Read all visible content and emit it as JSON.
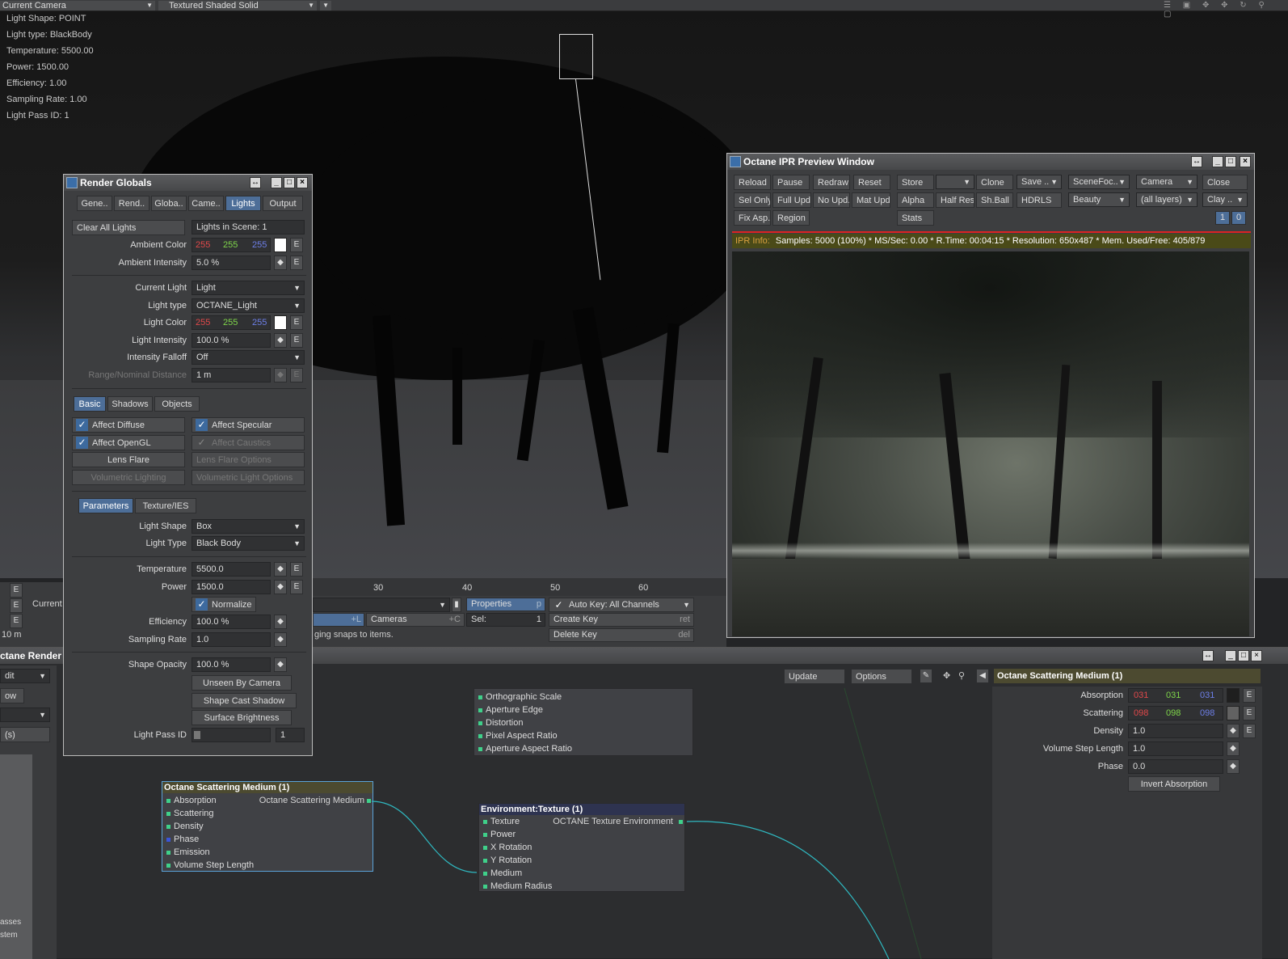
{
  "viewport": {
    "camera_dropdown": "Current Camera",
    "shading_dropdown": "Textured Shaded Solid",
    "info": [
      "Light Shape: POINT",
      "Light type: BlackBody",
      "Temperature: 5500.00",
      "Power: 1500.00",
      "Efficiency: 1.00",
      "Sampling Rate: 1.00",
      "Light Pass ID: 1"
    ]
  },
  "timeline": {
    "ticks": [
      "30",
      "40",
      "50",
      "60"
    ],
    "left_e": "E",
    "current_label": "Current",
    "size_label": "10 m",
    "properties": "Properties",
    "properties_key": "p",
    "auto_key": "Auto Key: All Channels",
    "cameras_shortcut": "+L",
    "cameras": "Cameras",
    "cameras_key": "+C",
    "sel_label": "Sel:",
    "sel_value": "1",
    "create_key": "Create Key",
    "create_key_shortcut": "ret",
    "delete_key": "Delete Key",
    "delete_key_shortcut": "del",
    "status": "ging snaps to items."
  },
  "render_globals": {
    "title": "Render Globals",
    "tabs": [
      "Gene..",
      "Rend..",
      "Globa..",
      "Came..",
      "Lights",
      "Output"
    ],
    "clear_all_lights": "Clear All Lights",
    "lights_in_scene": "Lights in Scene: 1",
    "ambient_color_label": "Ambient Color",
    "ambient_color": [
      "255",
      "255",
      "255"
    ],
    "ambient_intensity_label": "Ambient Intensity",
    "ambient_intensity": "5.0 %",
    "current_light_label": "Current Light",
    "current_light": "Light",
    "light_type_label": "Light type",
    "light_type": "OCTANE_Light",
    "light_color_label": "Light Color",
    "light_color": [
      "255",
      "255",
      "255"
    ],
    "light_intensity_label": "Light Intensity",
    "light_intensity": "100.0 %",
    "intensity_falloff_label": "Intensity Falloff",
    "intensity_falloff": "Off",
    "range_label": "Range/Nominal Distance",
    "range": "1 m",
    "subtabs": [
      "Basic",
      "Shadows",
      "Objects"
    ],
    "affect_diffuse": "Affect Diffuse",
    "affect_specular": "Affect Specular",
    "affect_opengl": "Affect OpenGL",
    "affect_caustics": "Affect Caustics",
    "lens_flare": "Lens Flare",
    "lens_flare_options": "Lens Flare Options",
    "volumetric_lighting": "Volumetric Lighting",
    "volumetric_light_options": "Volumetric Light Options",
    "param_tabs": [
      "Parameters",
      "Texture/IES"
    ],
    "light_shape_label": "Light Shape",
    "light_shape": "Box",
    "light_type2_label": "Light Type",
    "light_type2": "Black Body",
    "temperature_label": "Temperature",
    "temperature": "5500.0",
    "power_label": "Power",
    "power": "1500.0",
    "normalize": "Normalize",
    "efficiency_label": "Efficiency",
    "efficiency": "100.0 %",
    "sampling_rate_label": "Sampling Rate",
    "sampling_rate": "1.0",
    "shape_opacity_label": "Shape Opacity",
    "shape_opacity": "100.0 %",
    "unseen_by_camera": "Unseen By Camera",
    "shape_cast_shadow": "Shape Cast Shadow",
    "surface_brightness": "Surface Brightness",
    "light_pass_id_label": "Light Pass ID",
    "light_pass_id": "1",
    "e": "E"
  },
  "ipr": {
    "title": "Octane IPR Preview Window",
    "row1": [
      "Reload",
      "Pause",
      "Redraw",
      "Reset",
      "Store",
      "",
      "Clone",
      "Save ..",
      "SceneFoc..",
      "Camera",
      "Close"
    ],
    "row2": [
      "Sel Only",
      "Full Upd.",
      "No Upd.",
      "Mat Upd",
      "Alpha",
      "Half Res",
      "Sh.Ball",
      "HDRLS",
      "Beauty",
      "(all layers)",
      "Clay .."
    ],
    "row3": [
      "Fix Asp.",
      "Region",
      "Stats"
    ],
    "counters": [
      "1",
      "0"
    ],
    "info_label": "IPR Info:",
    "info_text": "Samples: 5000 (100%)  *  MS/Sec: 0.00  *  R.Time: 00:04:15  *  Resolution: 650x487  *  Mem. Used/Free: 405/879"
  },
  "node_editor": {
    "title_partial": "ctane Render",
    "left_items": [
      "dit",
      "ow",
      "(s)",
      "asses",
      "stem"
    ],
    "update": "Update",
    "options": "Options",
    "selected_node": "Octane Scattering Medium (1)",
    "camera_ports": [
      "Orthographic Scale",
      "Aperture Edge",
      "Distortion",
      "Pixel Aspect Ratio",
      "Aperture Aspect Ratio"
    ],
    "scatter_node": {
      "title": "Octane Scattering Medium (1)",
      "output": "Octane Scattering Medium",
      "ports": [
        "Absorption",
        "Scattering",
        "Density",
        "Phase",
        "Emission",
        "Volume Step Length"
      ]
    },
    "env_node": {
      "title": "Environment:Texture (1)",
      "output": "OCTANE Texture Environment",
      "ports": [
        "Texture",
        "Power",
        "X Rotation",
        "Y Rotation",
        "Medium",
        "Medium Radius"
      ]
    },
    "props": {
      "absorption_label": "Absorption",
      "absorption": [
        "031",
        "031",
        "031"
      ],
      "scattering_label": "Scattering",
      "scattering": [
        "098",
        "098",
        "098"
      ],
      "density_label": "Density",
      "density": "1.0",
      "volume_step_label": "Volume Step Length",
      "volume_step": "1.0",
      "phase_label": "Phase",
      "phase": "0.0",
      "invert_absorption": "Invert Absorption"
    }
  }
}
